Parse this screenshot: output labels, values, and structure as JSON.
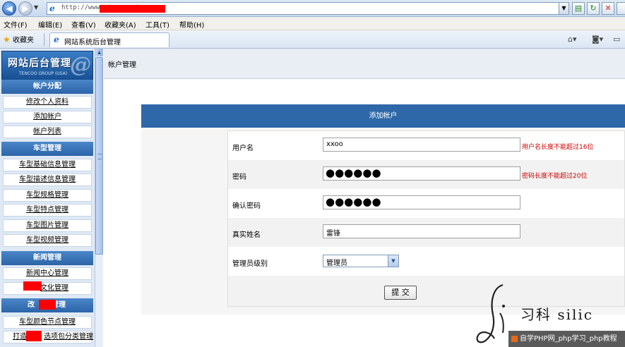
{
  "browser": {
    "url": "http://www.                    /manage/",
    "menu": [
      "文件(F)",
      "编辑(E)",
      "查看(V)",
      "收藏夹(A)",
      "工具(T)",
      "帮助(H)"
    ],
    "favorites_label": "收藏夹",
    "tab_title": "网站系统后台管理"
  },
  "sidebar": {
    "logo_title": "网站后台管理",
    "logo_subtitle": "TENCOO GROUP (USA)",
    "logo_mark": "@",
    "groups": [
      {
        "title": "帐户分配",
        "items": [
          "修改个人资料",
          "添加帐户",
          "帐户列表"
        ]
      },
      {
        "title": "车型管理",
        "items": [
          "车型基础信息管理",
          "车型描述信息管理",
          "车型规格管理",
          "车型特点管理",
          "车型图片管理",
          "车型视频管理"
        ]
      },
      {
        "title": "新闻管理",
        "items": [
          "新闻中心管理",
          "文化管理"
        ]
      },
      {
        "title": "改",
        "title_suffix": "管理",
        "items": [
          "车型颜色节点管理",
          "打造",
          "选项包分类管理"
        ]
      }
    ]
  },
  "main": {
    "breadcrumb": "帐户管理",
    "panel_title": "添加帐户",
    "fields": [
      {
        "label": "用户名",
        "value": "xxoo",
        "hint": "用户名长度不能超过16位"
      },
      {
        "label": "密码",
        "value": "●●●●●●",
        "hint": "密码长度不能超过20位"
      },
      {
        "label": "确认密码",
        "value": "●●●●●●",
        "hint": ""
      },
      {
        "label": "真实姓名",
        "value": "雷锋",
        "hint": ""
      },
      {
        "label": "管理员级别",
        "value": "管理员",
        "hint": ""
      }
    ],
    "submit_label": "提 交"
  },
  "watermark": {
    "text": "习科 silic",
    "url": "自学PHP网_php学习_php教程"
  },
  "icons": {
    "back": "back-arrow-icon",
    "forward": "forward-arrow-icon",
    "refresh": "refresh-icon",
    "stop": "stop-icon",
    "favorites": "star-icon",
    "page": "ie-page-icon"
  },
  "colors": {
    "accent": "#2e68a8",
    "sidebar_header": "#3a76ba",
    "hint": "#cc0000"
  }
}
